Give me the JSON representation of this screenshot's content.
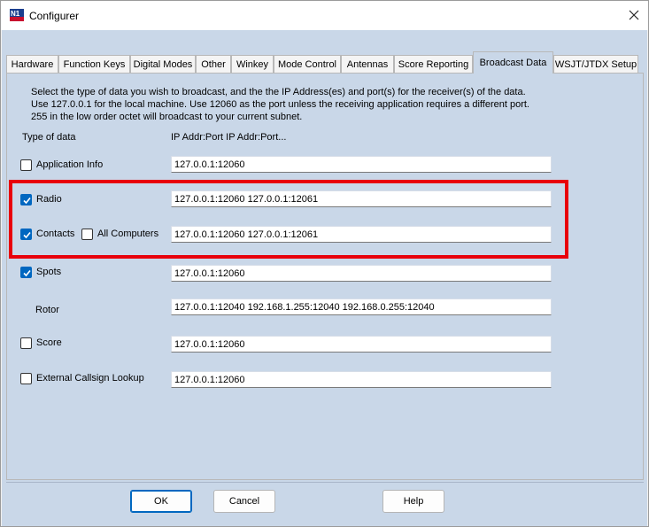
{
  "window": {
    "title": "Configurer",
    "app_icon": "n1mm-logo-icon",
    "close_icon": "close-icon"
  },
  "tabs": [
    {
      "label": "Hardware"
    },
    {
      "label": "Function Keys"
    },
    {
      "label": "Digital Modes"
    },
    {
      "label": "Other"
    },
    {
      "label": "Winkey"
    },
    {
      "label": "Mode Control"
    },
    {
      "label": "Antennas"
    },
    {
      "label": "Score Reporting"
    },
    {
      "label": "Broadcast Data",
      "active": true
    },
    {
      "label": "WSJT/JTDX Setup"
    }
  ],
  "description": [
    "Select the type of data you wish to broadcast, and the the IP Address(es) and port(s) for the receiver(s) of the data.",
    "Use 127.0.0.1 for the local machine.  Use 12060 as the port unless the receiving application requires a different port.",
    "255 in the low order octet will broadcast to your current subnet."
  ],
  "headers": {
    "type_of_data": "Type of data",
    "ip_addr": "IP Addr:Port IP Addr:Port..."
  },
  "rows": {
    "application_info": {
      "label": "Application Info",
      "checked": false,
      "value": "127.0.0.1:12060"
    },
    "radio": {
      "label": "Radio",
      "checked": true,
      "value": "127.0.0.1:12060 127.0.0.1:12061"
    },
    "contacts": {
      "label": "Contacts",
      "checked": true,
      "value": "127.0.0.1:12060 127.0.0.1:12061"
    },
    "all_computers": {
      "label": "All Computers",
      "checked": false
    },
    "spots": {
      "label": "Spots",
      "checked": true,
      "value": "127.0.0.1:12060"
    },
    "rotor": {
      "label": "Rotor",
      "value": "127.0.0.1:12040 192.168.1.255:12040 192.168.0.255:12040"
    },
    "score": {
      "label": "Score",
      "checked": false,
      "value": "127.0.0.1:12060"
    },
    "external_callsign_lookup": {
      "label": "External Callsign Lookup",
      "checked": false,
      "value": "127.0.0.1:12060"
    }
  },
  "buttons": {
    "ok": "OK",
    "cancel": "Cancel",
    "help": "Help"
  },
  "colors": {
    "panel_background": "#c9d7e8",
    "checkbox_checked": "#0067c0",
    "highlight_box": "#e8000b"
  }
}
